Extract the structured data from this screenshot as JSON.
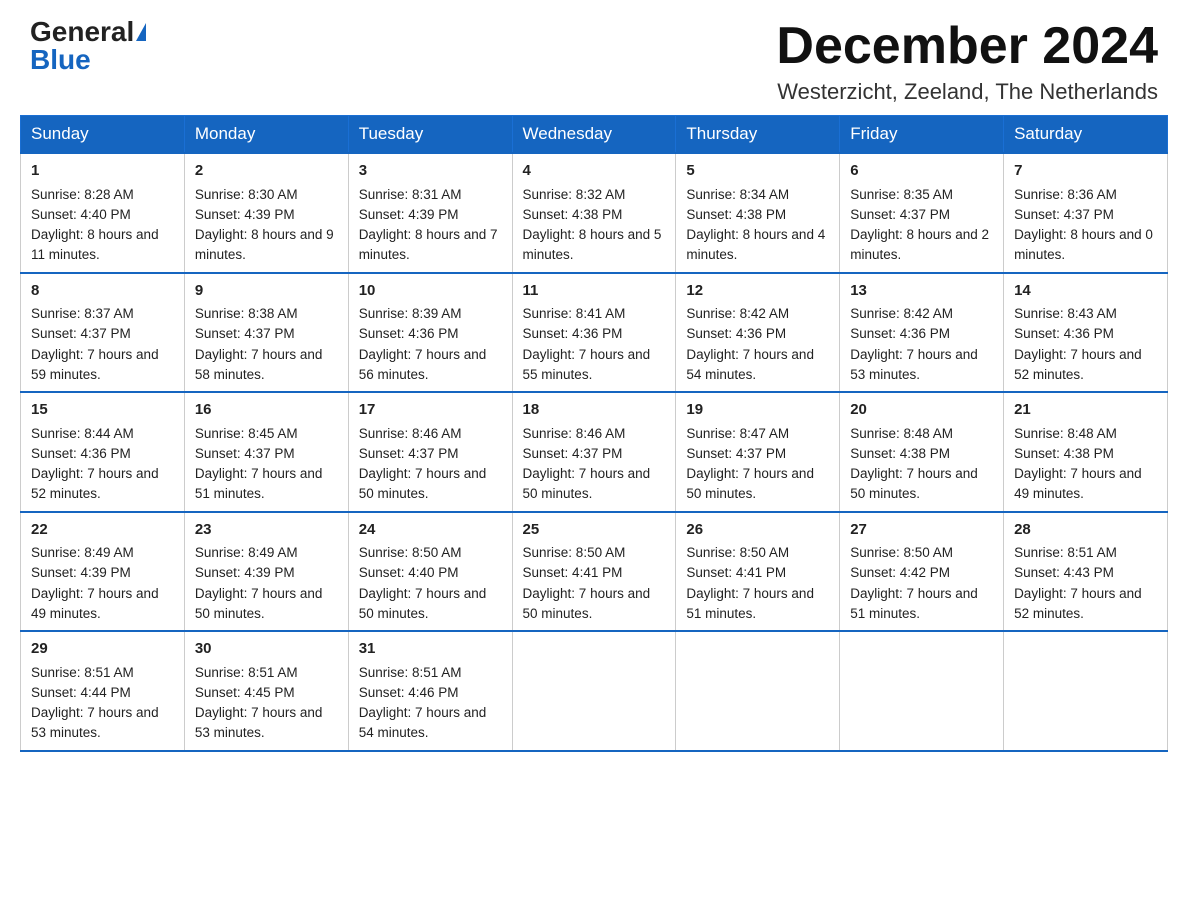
{
  "header": {
    "logo_general": "General",
    "logo_blue": "Blue",
    "month_year": "December 2024",
    "location": "Westerzicht, Zeeland, The Netherlands"
  },
  "columns": [
    "Sunday",
    "Monday",
    "Tuesday",
    "Wednesday",
    "Thursday",
    "Friday",
    "Saturday"
  ],
  "weeks": [
    [
      {
        "day": "1",
        "sunrise": "8:28 AM",
        "sunset": "4:40 PM",
        "daylight": "8 hours and 11 minutes."
      },
      {
        "day": "2",
        "sunrise": "8:30 AM",
        "sunset": "4:39 PM",
        "daylight": "8 hours and 9 minutes."
      },
      {
        "day": "3",
        "sunrise": "8:31 AM",
        "sunset": "4:39 PM",
        "daylight": "8 hours and 7 minutes."
      },
      {
        "day": "4",
        "sunrise": "8:32 AM",
        "sunset": "4:38 PM",
        "daylight": "8 hours and 5 minutes."
      },
      {
        "day": "5",
        "sunrise": "8:34 AM",
        "sunset": "4:38 PM",
        "daylight": "8 hours and 4 minutes."
      },
      {
        "day": "6",
        "sunrise": "8:35 AM",
        "sunset": "4:37 PM",
        "daylight": "8 hours and 2 minutes."
      },
      {
        "day": "7",
        "sunrise": "8:36 AM",
        "sunset": "4:37 PM",
        "daylight": "8 hours and 0 minutes."
      }
    ],
    [
      {
        "day": "8",
        "sunrise": "8:37 AM",
        "sunset": "4:37 PM",
        "daylight": "7 hours and 59 minutes."
      },
      {
        "day": "9",
        "sunrise": "8:38 AM",
        "sunset": "4:37 PM",
        "daylight": "7 hours and 58 minutes."
      },
      {
        "day": "10",
        "sunrise": "8:39 AM",
        "sunset": "4:36 PM",
        "daylight": "7 hours and 56 minutes."
      },
      {
        "day": "11",
        "sunrise": "8:41 AM",
        "sunset": "4:36 PM",
        "daylight": "7 hours and 55 minutes."
      },
      {
        "day": "12",
        "sunrise": "8:42 AM",
        "sunset": "4:36 PM",
        "daylight": "7 hours and 54 minutes."
      },
      {
        "day": "13",
        "sunrise": "8:42 AM",
        "sunset": "4:36 PM",
        "daylight": "7 hours and 53 minutes."
      },
      {
        "day": "14",
        "sunrise": "8:43 AM",
        "sunset": "4:36 PM",
        "daylight": "7 hours and 52 minutes."
      }
    ],
    [
      {
        "day": "15",
        "sunrise": "8:44 AM",
        "sunset": "4:36 PM",
        "daylight": "7 hours and 52 minutes."
      },
      {
        "day": "16",
        "sunrise": "8:45 AM",
        "sunset": "4:37 PM",
        "daylight": "7 hours and 51 minutes."
      },
      {
        "day": "17",
        "sunrise": "8:46 AM",
        "sunset": "4:37 PM",
        "daylight": "7 hours and 50 minutes."
      },
      {
        "day": "18",
        "sunrise": "8:46 AM",
        "sunset": "4:37 PM",
        "daylight": "7 hours and 50 minutes."
      },
      {
        "day": "19",
        "sunrise": "8:47 AM",
        "sunset": "4:37 PM",
        "daylight": "7 hours and 50 minutes."
      },
      {
        "day": "20",
        "sunrise": "8:48 AM",
        "sunset": "4:38 PM",
        "daylight": "7 hours and 50 minutes."
      },
      {
        "day": "21",
        "sunrise": "8:48 AM",
        "sunset": "4:38 PM",
        "daylight": "7 hours and 49 minutes."
      }
    ],
    [
      {
        "day": "22",
        "sunrise": "8:49 AM",
        "sunset": "4:39 PM",
        "daylight": "7 hours and 49 minutes."
      },
      {
        "day": "23",
        "sunrise": "8:49 AM",
        "sunset": "4:39 PM",
        "daylight": "7 hours and 50 minutes."
      },
      {
        "day": "24",
        "sunrise": "8:50 AM",
        "sunset": "4:40 PM",
        "daylight": "7 hours and 50 minutes."
      },
      {
        "day": "25",
        "sunrise": "8:50 AM",
        "sunset": "4:41 PM",
        "daylight": "7 hours and 50 minutes."
      },
      {
        "day": "26",
        "sunrise": "8:50 AM",
        "sunset": "4:41 PM",
        "daylight": "7 hours and 51 minutes."
      },
      {
        "day": "27",
        "sunrise": "8:50 AM",
        "sunset": "4:42 PM",
        "daylight": "7 hours and 51 minutes."
      },
      {
        "day": "28",
        "sunrise": "8:51 AM",
        "sunset": "4:43 PM",
        "daylight": "7 hours and 52 minutes."
      }
    ],
    [
      {
        "day": "29",
        "sunrise": "8:51 AM",
        "sunset": "4:44 PM",
        "daylight": "7 hours and 53 minutes."
      },
      {
        "day": "30",
        "sunrise": "8:51 AM",
        "sunset": "4:45 PM",
        "daylight": "7 hours and 53 minutes."
      },
      {
        "day": "31",
        "sunrise": "8:51 AM",
        "sunset": "4:46 PM",
        "daylight": "7 hours and 54 minutes."
      },
      null,
      null,
      null,
      null
    ]
  ]
}
